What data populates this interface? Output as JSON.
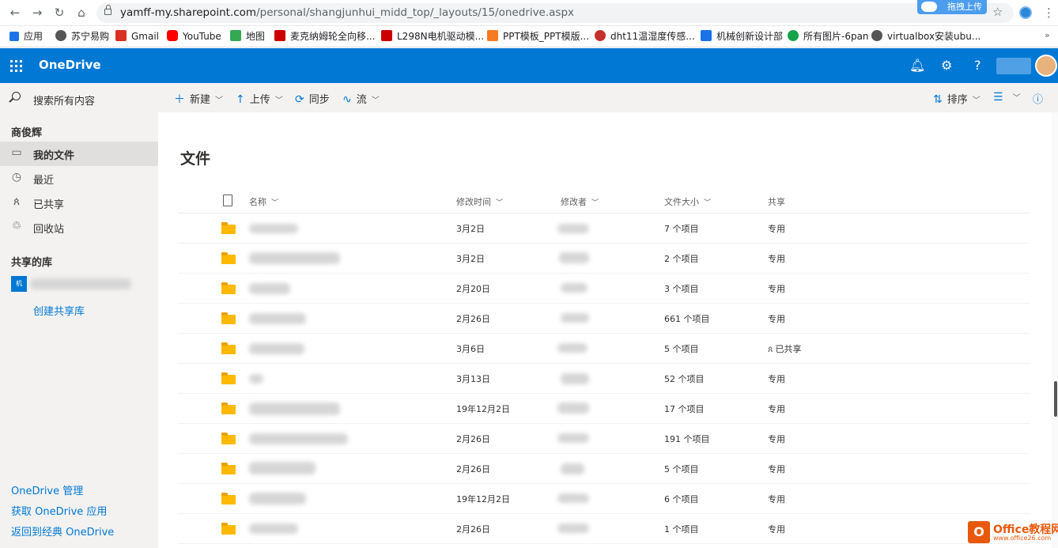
{
  "browser": {
    "url_host": "yamff-my.sharepoint.com",
    "url_path": "/personal/shangjunhui_midd_top/_layouts/15/onedrive.aspx",
    "extension_badge": "拖拽上传",
    "bookmarks": [
      {
        "label": "应用",
        "color": "#1a73e8"
      },
      {
        "label": "苏宁易购",
        "color": "#555555"
      },
      {
        "label": "Gmail",
        "color": "#d93025"
      },
      {
        "label": "YouTube",
        "color": "#ff0000"
      },
      {
        "label": "地图",
        "color": "#34a853"
      },
      {
        "label": "麦克纳姆轮全向移...",
        "color": "#cc0000"
      },
      {
        "label": "L298N电机驱动模...",
        "color": "#cc0000"
      },
      {
        "label": "PPT模板_PPT模版...",
        "color": "#f47b20"
      },
      {
        "label": "dht11温湿度传感...",
        "color": "#c4302b"
      },
      {
        "label": "机械创新设计部",
        "color": "#1a73e8"
      },
      {
        "label": "所有图片-6pan",
        "color": "#16a34a"
      },
      {
        "label": "virtualbox安装ubu...",
        "color": "#555555"
      }
    ],
    "more": "»"
  },
  "header": {
    "brand": "OneDrive"
  },
  "sidebar": {
    "search_placeholder": "搜索所有内容",
    "user_name": "商俊辉",
    "items": [
      {
        "label": "我的文件",
        "icon": "folder-icon"
      },
      {
        "label": "最近",
        "icon": "clock-icon"
      },
      {
        "label": "已共享",
        "icon": "people-icon"
      },
      {
        "label": "回收站",
        "icon": "recycle-bin-icon"
      }
    ],
    "shared_libraries": "共享的库",
    "library_tile": "机",
    "create_library": "创建共享库",
    "footer_links": [
      "OneDrive 管理",
      "获取 OneDrive 应用",
      "返回到经典 OneDrive"
    ]
  },
  "commands": {
    "new": "新建",
    "upload": "上传",
    "sync": "同步",
    "flow": "流",
    "sort": "排序"
  },
  "main": {
    "title": "文件",
    "columns": {
      "name": "名称",
      "modified": "修改时间",
      "modified_by": "修改者",
      "size": "文件大小",
      "sharing": "共享"
    },
    "rows": [
      {
        "modified": "3月2日",
        "size": "7 个项目",
        "sharing": "专用"
      },
      {
        "modified": "3月2日",
        "size": "2 个项目",
        "sharing": "专用"
      },
      {
        "modified": "2月20日",
        "size": "3 个项目",
        "sharing": "专用"
      },
      {
        "modified": "2月26日",
        "size": "661 个项目",
        "sharing": "专用"
      },
      {
        "modified": "3月6日",
        "size": "5 个项目",
        "sharing": "已共享"
      },
      {
        "modified": "3月13日",
        "size": "52 个项目",
        "sharing": "专用"
      },
      {
        "modified": "19年12月2日",
        "size": "17 个项目",
        "sharing": "专用"
      },
      {
        "modified": "2月26日",
        "size": "191 个项目",
        "sharing": "专用"
      },
      {
        "modified": "2月26日",
        "size": "5 个项目",
        "sharing": "专用"
      },
      {
        "modified": "19年12月2日",
        "size": "6 个项目",
        "sharing": "专用"
      },
      {
        "modified": "2月26日",
        "size": "1 个项目",
        "sharing": "专用"
      }
    ]
  },
  "watermark": {
    "title": "Office教程网",
    "url": "www.office26.com"
  },
  "colors": {
    "brand_blue": "#0078d4",
    "folder_yellow": "#ffb900",
    "sidebar_bg": "#f3f2f1"
  }
}
